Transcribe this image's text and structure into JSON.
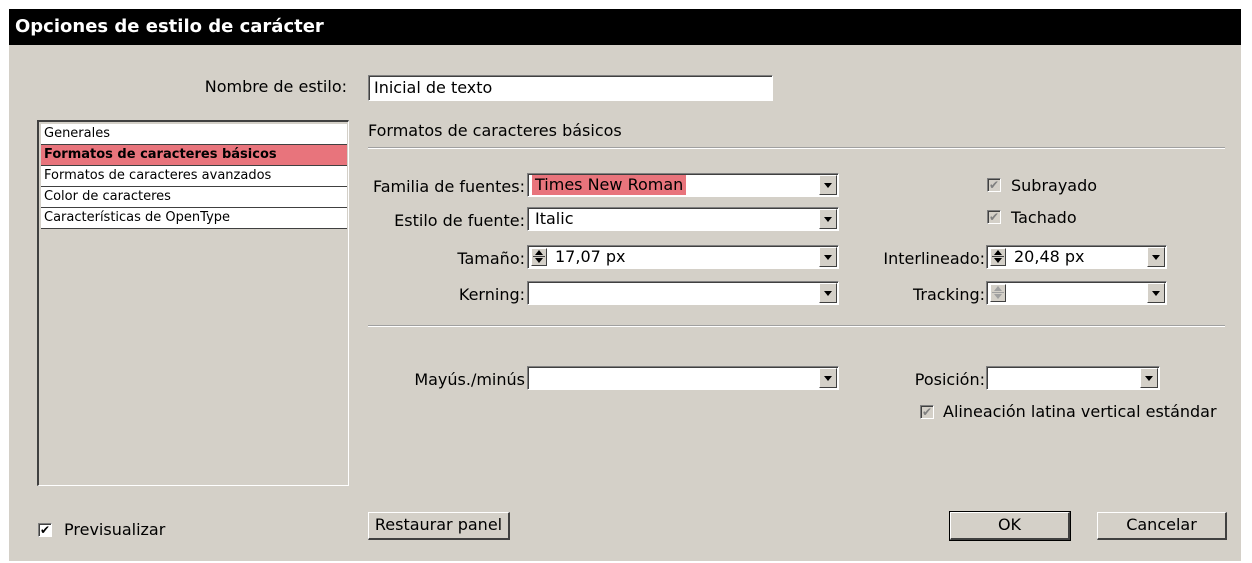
{
  "dialog": {
    "title": "Opciones de estilo de carácter"
  },
  "style_name": {
    "label": "Nombre de estilo:",
    "value": "Inicial de texto"
  },
  "sections": [
    {
      "label": "Generales",
      "selected": false
    },
    {
      "label": "Formatos de caracteres básicos",
      "selected": true
    },
    {
      "label": "Formatos de caracteres avanzados",
      "selected": false
    },
    {
      "label": "Color de caracteres",
      "selected": false
    },
    {
      "label": "Características de OpenType",
      "selected": false
    }
  ],
  "panel": {
    "heading": "Formatos de caracteres básicos",
    "font_family": {
      "label": "Familia de fuentes:",
      "value": "Times New Roman"
    },
    "font_style": {
      "label": "Estilo de fuente:",
      "value": "Italic"
    },
    "size": {
      "label": "Tamaño:",
      "value": "17,07 px"
    },
    "kerning": {
      "label": "Kerning:",
      "value": ""
    },
    "underline": {
      "label": "Subrayado",
      "checked": true,
      "enabled": false
    },
    "strikethrough": {
      "label": "Tachado",
      "checked": true,
      "enabled": false
    },
    "leading": {
      "label": "Interlineado:",
      "value": "20,48 px"
    },
    "tracking": {
      "label": "Tracking:",
      "value": ""
    },
    "case": {
      "label": "Mayús./minús",
      "value": ""
    },
    "position": {
      "label": "Posición:",
      "value": ""
    },
    "latin_vertical": {
      "label": "Alineación latina vertical estándar",
      "checked": true,
      "enabled": false
    }
  },
  "footer": {
    "preview": {
      "label": "Previsualizar",
      "checked": true
    },
    "reset_label": "Restaurar panel",
    "ok_label": "OK",
    "cancel_label": "Cancelar"
  },
  "colors": {
    "selection": "#e8747c",
    "face": "#d4d0c8",
    "titlebar": "#000000"
  },
  "glyphs": {
    "check": "✔"
  }
}
